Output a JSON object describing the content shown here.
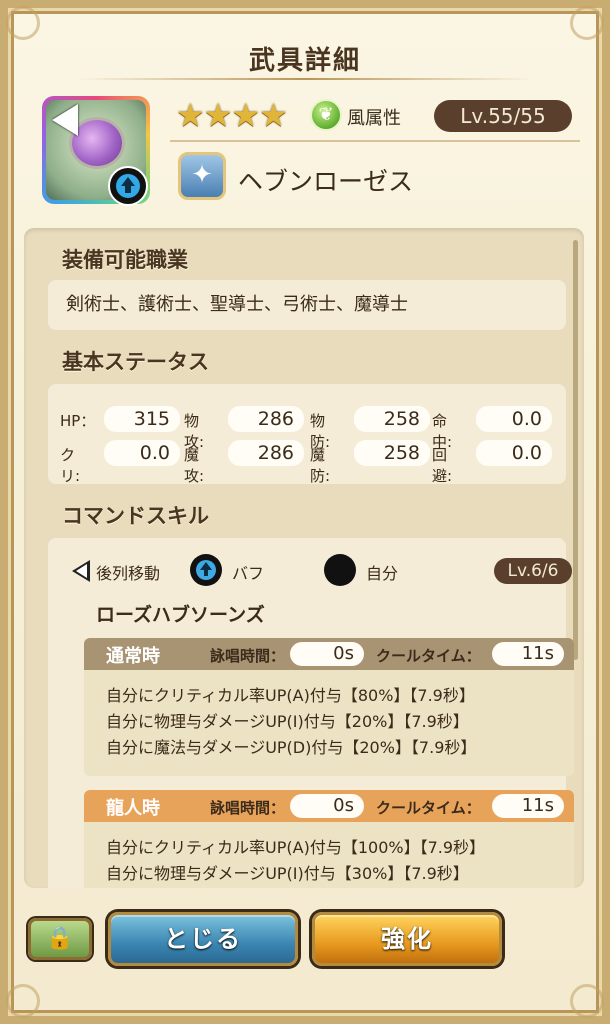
{
  "header": {
    "title": "武具詳細"
  },
  "weapon": {
    "rarity_stars": "★★★★",
    "attribute_icon": "wind-leaf-icon",
    "attribute_label": "風属性",
    "level": "Lv.55/55",
    "name": "ヘブンローゼス"
  },
  "jobs": {
    "heading": "装備可能職業",
    "list": "剣術士、護術士、聖導士、弓術士、魔導士"
  },
  "stats": {
    "heading": "基本ステータス",
    "items": [
      {
        "label": "HP：",
        "value": "315"
      },
      {
        "label": "物攻:",
        "value": "286"
      },
      {
        "label": "物防:",
        "value": "258"
      },
      {
        "label": "命中:",
        "value": "0.0"
      },
      {
        "label": "クリ:",
        "value": "0.0"
      },
      {
        "label": "魔攻:",
        "value": "286"
      },
      {
        "label": "魔防:",
        "value": "258"
      },
      {
        "label": "回避:",
        "value": "0.0"
      }
    ]
  },
  "command_skill": {
    "heading": "コマンドスキル",
    "tags": [
      "後列移動",
      "バフ",
      "自分"
    ],
    "level": "Lv.6/6",
    "name": "ローズハブソーンズ",
    "normal": {
      "title": "通常時",
      "cast_label": "詠唱時間：",
      "cast_value": "0s",
      "cool_label": "クールタイム：",
      "cool_value": "11s",
      "effects": [
        "自分にクリティカル率UP(A)付与【80%】【7.9秒】",
        "自分に物理与ダメージUP(I)付与【20%】【7.9秒】",
        "自分に魔法与ダメージUP(D)付与【20%】【7.9秒】"
      ]
    },
    "dragon": {
      "title": "龍人時",
      "cast_label": "詠唱時間：",
      "cast_value": "0s",
      "cool_label": "クールタイム：",
      "cool_value": "11s",
      "effects": [
        "自分にクリティカル率UP(A)付与【100%】【7.9秒】",
        "自分に物理与ダメージUP(I)付与【30%】【7.9秒】"
      ]
    }
  },
  "footer": {
    "close_label": "とじる",
    "enhance_label": "強化",
    "lock_icon": "lock-icon"
  },
  "colors": {
    "panel_bg": "#f6efd6",
    "level_pill": "#5a3f2c",
    "normal_header": "#a89373",
    "dragon_header": "#e8a35b",
    "close_button": "#3b86b2",
    "enhance_button": "#e89a1f"
  }
}
